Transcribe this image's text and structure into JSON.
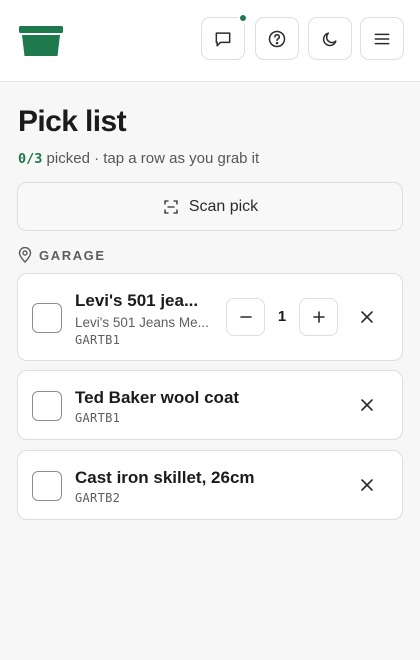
{
  "header": {
    "logo_icon": "green-bin-icon",
    "buttons": [
      {
        "name": "feedback-button",
        "icon": "message-square-icon",
        "has_notification": true
      },
      {
        "name": "help-button",
        "icon": "help-circle-icon"
      },
      {
        "name": "theme-toggle-button",
        "icon": "moon-icon"
      },
      {
        "name": "menu-button",
        "icon": "menu-icon"
      }
    ]
  },
  "page": {
    "title": "Pick list",
    "progress_count": "0/3",
    "progress_text": " picked · tap a row as you grab it"
  },
  "scan_button": {
    "label": "Scan pick",
    "icon": "scan-icon"
  },
  "section": {
    "label": "GARAGE",
    "icon": "map-pin-icon"
  },
  "items": [
    {
      "name": "Levi's 501 jea...",
      "description": "Levi's 501 Jeans Me...",
      "location": "GARTB1",
      "quantity": "1",
      "picked": false
    },
    {
      "name": "Ted Baker wool coat",
      "location": "GARTB1",
      "picked": false
    },
    {
      "name": "Cast iron skillet, 26cm",
      "location": "GARTB2",
      "picked": false
    }
  ],
  "colors": {
    "accent": "#1e7a4c",
    "background": "#f6f7f6",
    "card": "#ffffff",
    "border": "#dcdfdc"
  }
}
